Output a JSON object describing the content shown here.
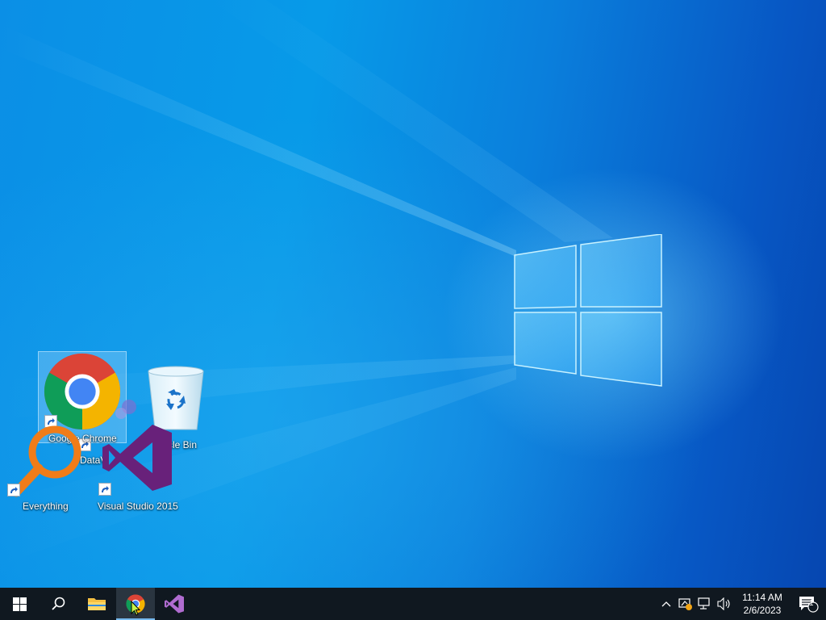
{
  "desktop": {
    "icons": [
      {
        "name": "Google Chrome",
        "selected": true,
        "shortcut": true
      },
      {
        "name": "Recycle Bin",
        "partial_label": "ycle Bin",
        "shortcut": false
      },
      {
        "name": "DataV",
        "partial_label": "DataV",
        "shortcut": true
      },
      {
        "name": "Everything",
        "shortcut": true
      },
      {
        "name": "Visual Studio 2015",
        "shortcut": true
      }
    ]
  },
  "taskbar": {
    "buttons": [
      {
        "name": "Start",
        "icon": "windows-logo-icon"
      },
      {
        "name": "Search",
        "icon": "search-icon"
      },
      {
        "name": "File Explorer",
        "icon": "folder-icon"
      },
      {
        "name": "Google Chrome",
        "icon": "chrome-icon",
        "active": true,
        "running": true
      },
      {
        "name": "Visual Studio",
        "icon": "visual-studio-icon"
      }
    ],
    "tray": {
      "icons": [
        "chevron-up-icon",
        "security-warning-icon",
        "network-icon",
        "volume-icon"
      ],
      "time": "11:14 AM",
      "date": "2/6/2023",
      "notification_count": "1"
    }
  },
  "colors": {
    "taskbar_bg": "#101820",
    "accent": "#76b9ed",
    "vs_purple": "#68217a",
    "chrome_red": "#db4437",
    "chrome_green": "#0f9d58",
    "chrome_yellow": "#f4b400",
    "chrome_blue": "#4285f4"
  }
}
